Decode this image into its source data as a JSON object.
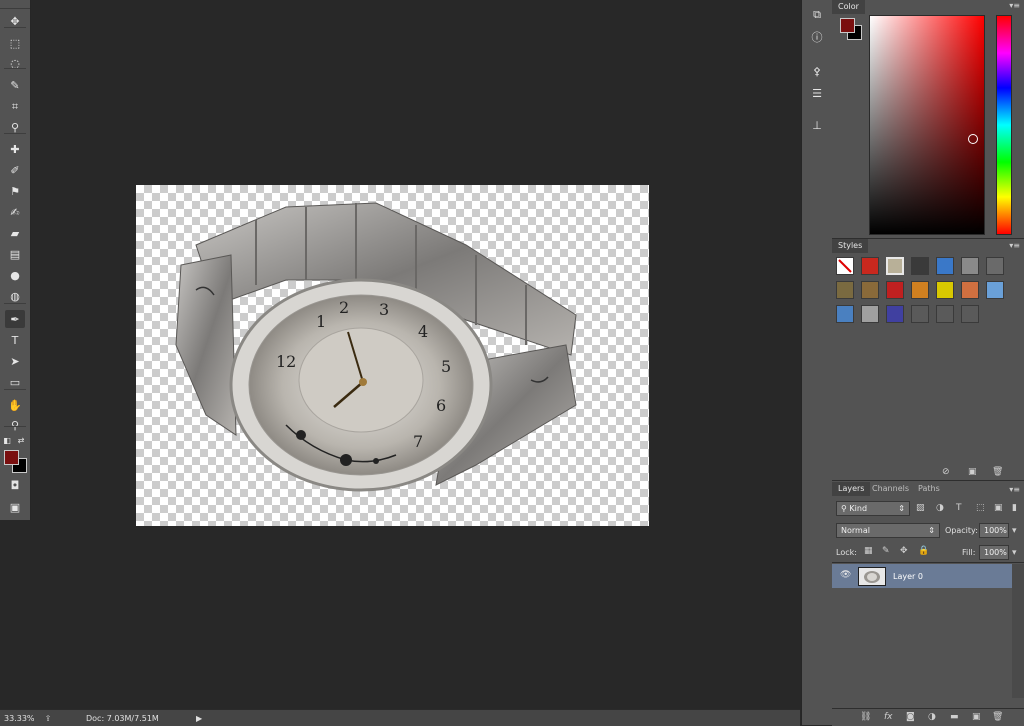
{
  "app": {
    "accent_colors": {
      "foreground_swatch": "#7a0f0f",
      "background_swatch": "#000000",
      "selected_layer_bg": "#6a7b96"
    }
  },
  "toolbar": {
    "tools": [
      {
        "icon": "move-icon",
        "glyph": "✥"
      },
      {
        "icon": "marquee-icon",
        "glyph": "⬚"
      },
      {
        "icon": "lasso-icon",
        "glyph": "◌"
      },
      {
        "icon": "quick-selection-icon",
        "glyph": "✎"
      },
      {
        "icon": "crop-icon",
        "glyph": "⌗"
      },
      {
        "icon": "eyedropper-icon",
        "glyph": "⚲"
      },
      {
        "icon": "healing-brush-icon",
        "glyph": "✚"
      },
      {
        "icon": "brush-icon",
        "glyph": "✐"
      },
      {
        "icon": "clone-stamp-icon",
        "glyph": "⚑"
      },
      {
        "icon": "history-brush-icon",
        "glyph": "✍"
      },
      {
        "icon": "eraser-icon",
        "glyph": "▰"
      },
      {
        "icon": "gradient-icon",
        "glyph": "▤"
      },
      {
        "icon": "blur-icon",
        "glyph": "●"
      },
      {
        "icon": "dodge-icon",
        "glyph": "◍"
      },
      {
        "icon": "pen-icon",
        "glyph": "✒"
      },
      {
        "icon": "type-icon",
        "glyph": "T"
      },
      {
        "icon": "path-selection-icon",
        "glyph": "➤"
      },
      {
        "icon": "rectangle-icon",
        "glyph": "▭"
      },
      {
        "icon": "hand-icon",
        "glyph": "✋"
      },
      {
        "icon": "zoom-icon",
        "glyph": "⚲"
      }
    ]
  },
  "statusbar": {
    "zoom": "33.33%",
    "doc_size": "Doc: 7.03M/7.51M",
    "menu_arrow": "▶"
  },
  "color_panel": {
    "tab_label": "Color",
    "menu_glyph": "▾≡"
  },
  "styles_panel": {
    "tab_label": "Styles",
    "menu_glyph": "▾≡",
    "swatches": [
      "#ffffff",
      "#c8281e",
      "#b8b098",
      "#3a3a3a",
      "#3a78c8",
      "#8a8a8a",
      "#6a6a6a",
      "#7a6a40",
      "#8a6a3a",
      "#c02020",
      "#d08020",
      "#d8c800",
      "#d07040",
      "#6aa0d8",
      "#4a80c0",
      "#a0a0a0",
      "#4040a0",
      "#5a5a5a",
      "#5a5a5a",
      "#5a5a5a"
    ]
  },
  "layers_panel": {
    "tabs": [
      {
        "label": "Layers"
      },
      {
        "label": "Channels"
      },
      {
        "label": "Paths"
      }
    ],
    "menu_glyph": "▾≡",
    "filter_kind": "Kind",
    "blend_mode": "Normal",
    "opacity_label": "Opacity:",
    "opacity_value": "100%",
    "lock_label": "Lock:",
    "fill_label": "Fill:",
    "fill_value": "100%",
    "layers": [
      {
        "name": "Layer 0"
      }
    ]
  }
}
